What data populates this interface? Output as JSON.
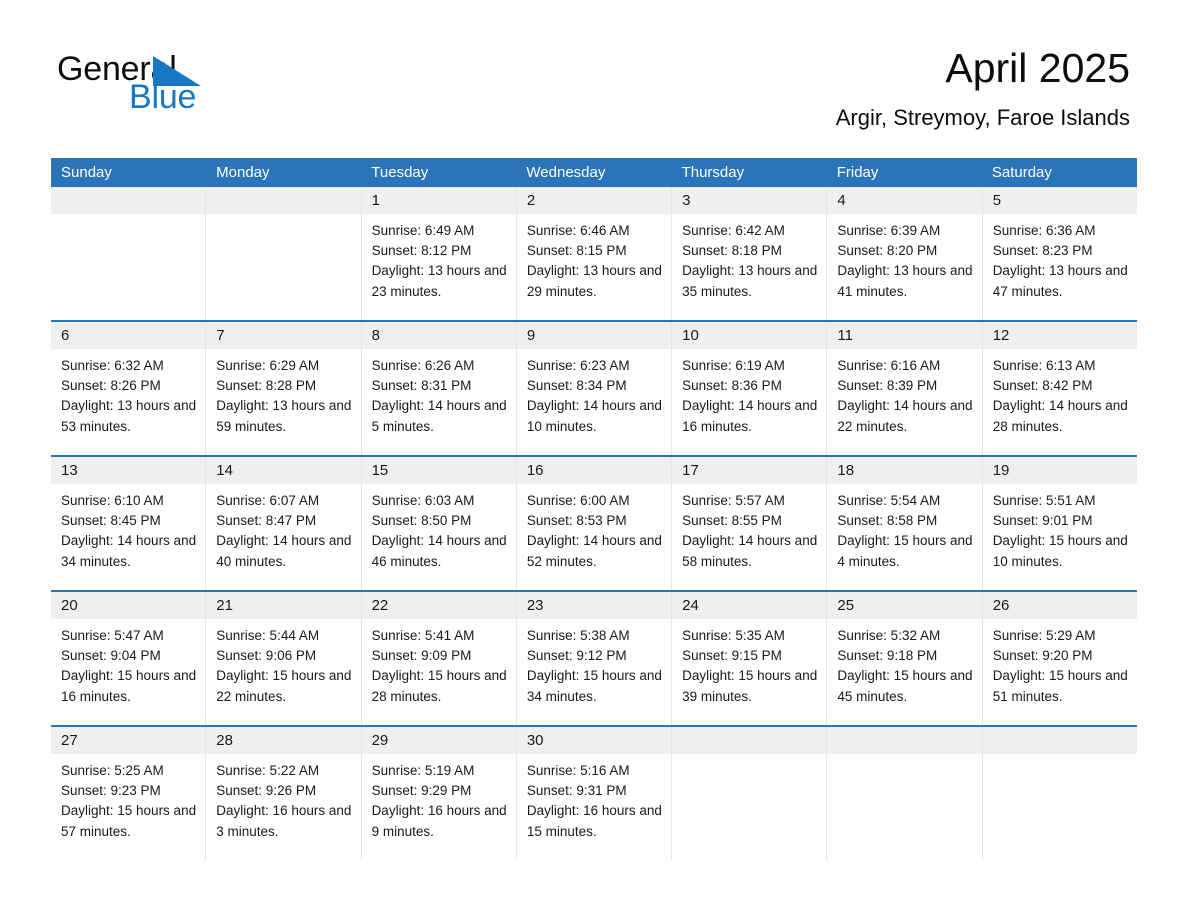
{
  "brand": {
    "word_one": "General",
    "word_two": "Blue",
    "triangle_icon": "triangle-icon",
    "accent_color": "#1878c4"
  },
  "header": {
    "title": "April 2025",
    "subtitle": "Argir, Streymoy, Faroe Islands"
  },
  "theme": {
    "header_blue": "#2b74b8",
    "daynum_band": "#efefef",
    "text": "#1a1a1a"
  },
  "calendar": {
    "weekday_headers": [
      "Sunday",
      "Monday",
      "Tuesday",
      "Wednesday",
      "Thursday",
      "Friday",
      "Saturday"
    ],
    "weeks": [
      [
        {
          "day": "",
          "empty": true
        },
        {
          "day": "",
          "empty": true
        },
        {
          "day": "1",
          "sunrise": "Sunrise: 6:49 AM",
          "sunset": "Sunset: 8:12 PM",
          "daylight": "Daylight: 13 hours and 23 minutes."
        },
        {
          "day": "2",
          "sunrise": "Sunrise: 6:46 AM",
          "sunset": "Sunset: 8:15 PM",
          "daylight": "Daylight: 13 hours and 29 minutes."
        },
        {
          "day": "3",
          "sunrise": "Sunrise: 6:42 AM",
          "sunset": "Sunset: 8:18 PM",
          "daylight": "Daylight: 13 hours and 35 minutes."
        },
        {
          "day": "4",
          "sunrise": "Sunrise: 6:39 AM",
          "sunset": "Sunset: 8:20 PM",
          "daylight": "Daylight: 13 hours and 41 minutes."
        },
        {
          "day": "5",
          "sunrise": "Sunrise: 6:36 AM",
          "sunset": "Sunset: 8:23 PM",
          "daylight": "Daylight: 13 hours and 47 minutes."
        }
      ],
      [
        {
          "day": "6",
          "sunrise": "Sunrise: 6:32 AM",
          "sunset": "Sunset: 8:26 PM",
          "daylight": "Daylight: 13 hours and 53 minutes."
        },
        {
          "day": "7",
          "sunrise": "Sunrise: 6:29 AM",
          "sunset": "Sunset: 8:28 PM",
          "daylight": "Daylight: 13 hours and 59 minutes."
        },
        {
          "day": "8",
          "sunrise": "Sunrise: 6:26 AM",
          "sunset": "Sunset: 8:31 PM",
          "daylight": "Daylight: 14 hours and 5 minutes."
        },
        {
          "day": "9",
          "sunrise": "Sunrise: 6:23 AM",
          "sunset": "Sunset: 8:34 PM",
          "daylight": "Daylight: 14 hours and 10 minutes."
        },
        {
          "day": "10",
          "sunrise": "Sunrise: 6:19 AM",
          "sunset": "Sunset: 8:36 PM",
          "daylight": "Daylight: 14 hours and 16 minutes."
        },
        {
          "day": "11",
          "sunrise": "Sunrise: 6:16 AM",
          "sunset": "Sunset: 8:39 PM",
          "daylight": "Daylight: 14 hours and 22 minutes."
        },
        {
          "day": "12",
          "sunrise": "Sunrise: 6:13 AM",
          "sunset": "Sunset: 8:42 PM",
          "daylight": "Daylight: 14 hours and 28 minutes."
        }
      ],
      [
        {
          "day": "13",
          "sunrise": "Sunrise: 6:10 AM",
          "sunset": "Sunset: 8:45 PM",
          "daylight": "Daylight: 14 hours and 34 minutes."
        },
        {
          "day": "14",
          "sunrise": "Sunrise: 6:07 AM",
          "sunset": "Sunset: 8:47 PM",
          "daylight": "Daylight: 14 hours and 40 minutes."
        },
        {
          "day": "15",
          "sunrise": "Sunrise: 6:03 AM",
          "sunset": "Sunset: 8:50 PM",
          "daylight": "Daylight: 14 hours and 46 minutes."
        },
        {
          "day": "16",
          "sunrise": "Sunrise: 6:00 AM",
          "sunset": "Sunset: 8:53 PM",
          "daylight": "Daylight: 14 hours and 52 minutes."
        },
        {
          "day": "17",
          "sunrise": "Sunrise: 5:57 AM",
          "sunset": "Sunset: 8:55 PM",
          "daylight": "Daylight: 14 hours and 58 minutes."
        },
        {
          "day": "18",
          "sunrise": "Sunrise: 5:54 AM",
          "sunset": "Sunset: 8:58 PM",
          "daylight": "Daylight: 15 hours and 4 minutes."
        },
        {
          "day": "19",
          "sunrise": "Sunrise: 5:51 AM",
          "sunset": "Sunset: 9:01 PM",
          "daylight": "Daylight: 15 hours and 10 minutes."
        }
      ],
      [
        {
          "day": "20",
          "sunrise": "Sunrise: 5:47 AM",
          "sunset": "Sunset: 9:04 PM",
          "daylight": "Daylight: 15 hours and 16 minutes."
        },
        {
          "day": "21",
          "sunrise": "Sunrise: 5:44 AM",
          "sunset": "Sunset: 9:06 PM",
          "daylight": "Daylight: 15 hours and 22 minutes."
        },
        {
          "day": "22",
          "sunrise": "Sunrise: 5:41 AM",
          "sunset": "Sunset: 9:09 PM",
          "daylight": "Daylight: 15 hours and 28 minutes."
        },
        {
          "day": "23",
          "sunrise": "Sunrise: 5:38 AM",
          "sunset": "Sunset: 9:12 PM",
          "daylight": "Daylight: 15 hours and 34 minutes."
        },
        {
          "day": "24",
          "sunrise": "Sunrise: 5:35 AM",
          "sunset": "Sunset: 9:15 PM",
          "daylight": "Daylight: 15 hours and 39 minutes."
        },
        {
          "day": "25",
          "sunrise": "Sunrise: 5:32 AM",
          "sunset": "Sunset: 9:18 PM",
          "daylight": "Daylight: 15 hours and 45 minutes."
        },
        {
          "day": "26",
          "sunrise": "Sunrise: 5:29 AM",
          "sunset": "Sunset: 9:20 PM",
          "daylight": "Daylight: 15 hours and 51 minutes."
        }
      ],
      [
        {
          "day": "27",
          "sunrise": "Sunrise: 5:25 AM",
          "sunset": "Sunset: 9:23 PM",
          "daylight": "Daylight: 15 hours and 57 minutes."
        },
        {
          "day": "28",
          "sunrise": "Sunrise: 5:22 AM",
          "sunset": "Sunset: 9:26 PM",
          "daylight": "Daylight: 16 hours and 3 minutes."
        },
        {
          "day": "29",
          "sunrise": "Sunrise: 5:19 AM",
          "sunset": "Sunset: 9:29 PM",
          "daylight": "Daylight: 16 hours and 9 minutes."
        },
        {
          "day": "30",
          "sunrise": "Sunrise: 5:16 AM",
          "sunset": "Sunset: 9:31 PM",
          "daylight": "Daylight: 16 hours and 15 minutes."
        },
        {
          "day": "",
          "empty": true
        },
        {
          "day": "",
          "empty": true
        },
        {
          "day": "",
          "empty": true
        }
      ]
    ]
  }
}
